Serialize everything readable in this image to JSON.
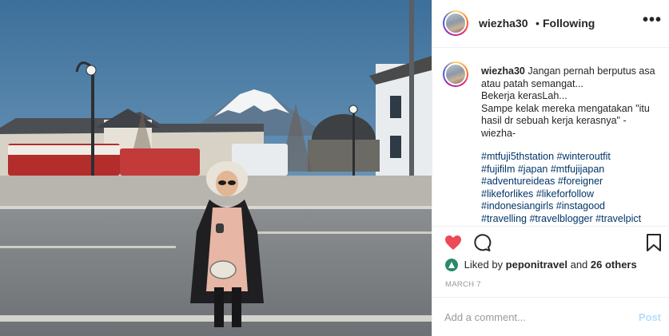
{
  "post": {
    "username": "wiezha30",
    "separator": "•",
    "follow_label": "Following",
    "more_icon": "more-options-icon",
    "caption": {
      "username": "wiezha30",
      "lines": [
        "Jangan pernah berputus asa",
        "atau patah semangat...",
        "Bekerja kerasLah...",
        "Sampe kelak mereka mengatakan \"itu",
        "hasil dr sebuah kerja kerasnya\" -",
        "wiezha-"
      ],
      "hashtag_lines": [
        "#mtfuji5thstation #winteroutfit",
        "#fujifilm #japan #mtfujijapan",
        "#adventureideas #foreigner",
        "#likeforlikes #likeforfollow",
        "#indonesiangirls #instagood",
        "#travelling #travelblogger #travelpict"
      ]
    },
    "likes": {
      "prefix": "Liked by",
      "user": "peponitravel",
      "middle": "and",
      "others": "26 others"
    },
    "date": "MARCH 7",
    "comment": {
      "placeholder": "Add a comment...",
      "post_label": "Post"
    },
    "colors": {
      "like_red": "#ed4956",
      "hashtag_blue": "#003569",
      "post_disabled": "#b2dffc"
    }
  }
}
